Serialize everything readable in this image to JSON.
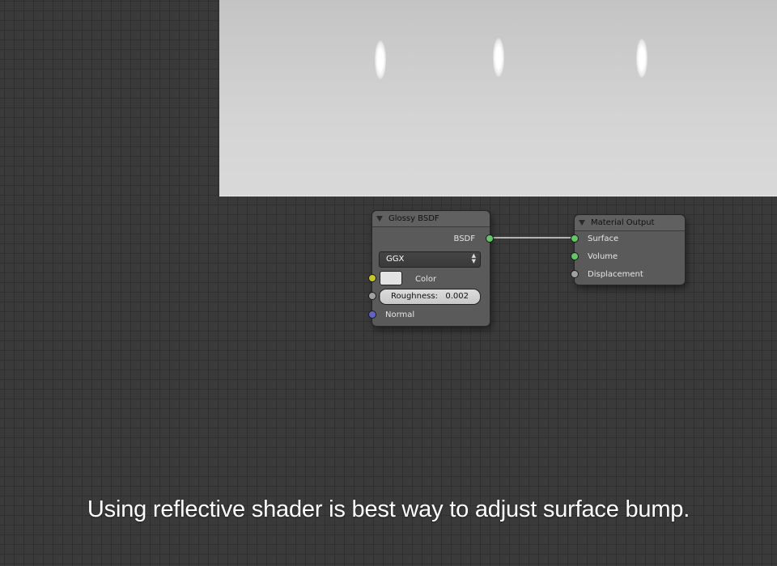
{
  "colors": {
    "shader_socket": "#63c763",
    "color_socket": "#c7c729",
    "value_socket": "#a1a1a1",
    "vector_socket": "#6363c7",
    "link": "#b4b4b4"
  },
  "preview": {
    "icon": "render-preview"
  },
  "glossy_node": {
    "title": "Glossy BSDF",
    "output_label": "BSDF",
    "distribution": "GGX",
    "color_label": "Color",
    "color_value": "#e3e3e3",
    "roughness_label": "Roughness:",
    "roughness_value": "0.002",
    "roughness_fraction": 0.002,
    "normal_label": "Normal"
  },
  "material_output": {
    "title": "Material Output",
    "inputs": [
      "Surface",
      "Volume",
      "Displacement"
    ]
  },
  "caption": "Using reflective shader is best way to adjust surface bump."
}
